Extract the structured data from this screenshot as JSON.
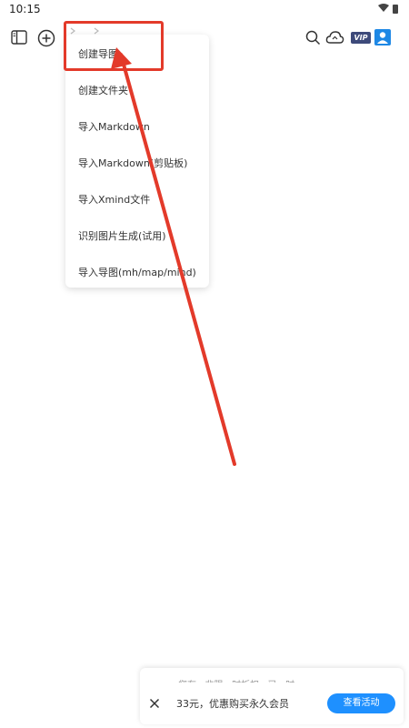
{
  "status_bar": {
    "time": "10:15"
  },
  "toolbar": {
    "sidebar_icon": "sidebar-toggle-icon",
    "add_icon": "add-circle-icon",
    "search_icon": "search-icon",
    "cloud_icon": "cloud-sync-icon",
    "vip_label": "VIP",
    "user_icon": "user-icon"
  },
  "menu": {
    "items": [
      {
        "label": "创建导图"
      },
      {
        "label": "创建文件夹"
      },
      {
        "label": "导入Markdown"
      },
      {
        "label": "导入Markdown(剪贴板)"
      },
      {
        "label": "导入Xmind文件"
      },
      {
        "label": "识别图片生成(试用)"
      },
      {
        "label": "导入导图(mh/map/mind)"
      }
    ]
  },
  "annotation": {
    "color": "#e33a2a"
  },
  "promo": {
    "peek_text": "您有 · 非限 · 时折扣 · 已 · 时",
    "text": "33元，优惠购买永久会员",
    "button_label": "查看活动",
    "button_color": "#1e90ff"
  }
}
